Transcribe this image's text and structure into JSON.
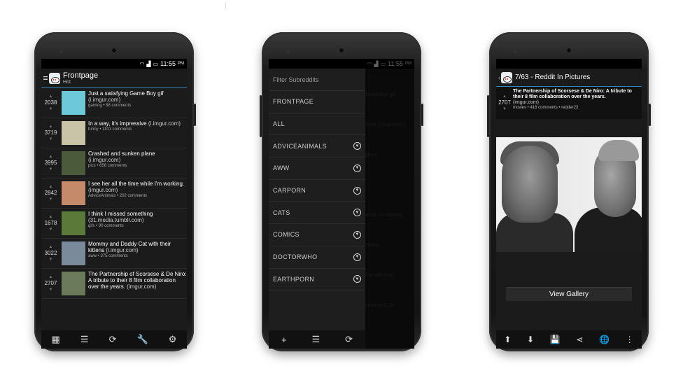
{
  "status": {
    "time": "11:55",
    "ampm": "PM"
  },
  "phone1": {
    "title": "Frontpage",
    "subtitle": "Hot",
    "posts": [
      {
        "score": "2038",
        "title": "Just a satisfying Game Boy gif",
        "domain": "(i.imgur.com)",
        "meta": "gaming • 88 comments",
        "thumb": "#6dc8d8"
      },
      {
        "score": "3719",
        "title": "In a way, it's impressive",
        "domain": "(i.imgur.com)",
        "meta": "funny • 1101 comments",
        "thumb": "#c9c3a8"
      },
      {
        "score": "3995",
        "title": "Crashed and sunken plane",
        "domain": "(i.imgur.com)",
        "meta": "pics • 656 comments",
        "thumb": "#4a5a3a"
      },
      {
        "score": "2842",
        "title": "I see her all the time while I'm working.",
        "domain": "(imgur.com)",
        "meta": "AdviceAnimals • 202 comments",
        "thumb": "#c48a6a"
      },
      {
        "score": "1678",
        "title": "I think I missed something",
        "domain": "(31.media.tumblr.com)",
        "meta": "gifs • 90 comments",
        "thumb": "#5b7a3a"
      },
      {
        "score": "3022",
        "title": "Mommy and Daddy Cat with their kittens",
        "domain": "(i.imgur.com)",
        "meta": "aww • 375 comments",
        "thumb": "#7a8a9a"
      },
      {
        "score": "2707",
        "title": "The Partnership of Scorsese & De Niro: A tribute to their 8 film collaboration over the years.",
        "domain": "(imgur.com)",
        "meta": "",
        "thumb": "#6a7a5a"
      }
    ]
  },
  "phone2": {
    "filter_placeholder": "Filter Subreddits",
    "items": [
      "FRONTPAGE",
      "ALL",
      "ADVICEANIMALS",
      "AWW",
      "CARPORN",
      "CATS",
      "COMICS",
      "DOCTORWHO",
      "EARTHPORN"
    ],
    "ghost": [
      "Game Boy gif",
      "ssive (i.imgur.com)",
      "plane",
      "",
      "while I'm working.",
      "ething",
      "Cat with their",
      "corsese & De"
    ]
  },
  "phone3": {
    "title": "7/63 - Reddit In Pictures",
    "score": "2707",
    "post_title": "The Partnership of Scorsese & De Niro: A tribute to their 8 film collaboration over the years.",
    "domain": "(imgur.com)",
    "meta": "movies • 418 comments • redder23",
    "view_gallery": "View Gallery"
  },
  "icons": {
    "grid": "▦",
    "sort": "☰",
    "refresh": "⟳",
    "wrench": "🔧",
    "tune": "⚙",
    "plus": "+",
    "up": "⬆",
    "down": "⬇",
    "save": "💾",
    "share": "⋖",
    "globe": "🌐",
    "more": "⋮"
  }
}
